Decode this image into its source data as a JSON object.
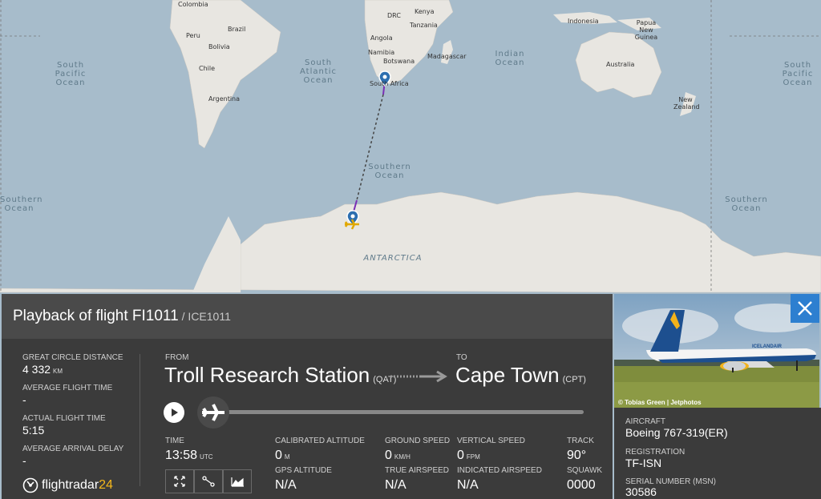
{
  "map": {
    "countries": [
      "Colombia",
      "Peru",
      "Brazil",
      "Bolivia",
      "Chile",
      "Argentina",
      "DRC",
      "Kenya",
      "Tanzania",
      "Angola",
      "Namibia",
      "Botswana",
      "Madagascar",
      "South Africa",
      "Indonesia",
      "Papua New Guinea",
      "Australia",
      "New Zealand"
    ],
    "oceans": {
      "south_pacific_left": "South\nPacific\nOcean",
      "south_atlantic": "South\nAtlantic\nOcean",
      "indian": "Indian\nOcean",
      "south_pacific_right": "South\nPacific\nOcean",
      "southern_center": "Southern\nOcean",
      "southern_left": "Southern\nOcean",
      "southern_right": "Southern\nOcean"
    },
    "continent_label": "ANTARCTICA"
  },
  "flight": {
    "title": "Playback of flight FI1011",
    "callsign": "/ ICE1011"
  },
  "stats": {
    "distance_label": "GREAT CIRCLE DISTANCE",
    "distance_value": "4 332",
    "distance_unit": "KM",
    "avg_time_label": "AVERAGE FLIGHT TIME",
    "avg_time_value": "-",
    "actual_time_label": "ACTUAL FLIGHT TIME",
    "actual_time_value": "5:15",
    "avg_delay_label": "AVERAGE ARRIVAL DELAY",
    "avg_delay_value": "-"
  },
  "route": {
    "from_label": "FROM",
    "from_city": "Troll Research Station",
    "from_code": "(QAT)",
    "to_label": "TO",
    "to_city": "Cape Town",
    "to_code": "(CPT)"
  },
  "telemetry": {
    "time_label": "TIME",
    "time_value": "13:58",
    "time_unit": "UTC",
    "cal_alt_label": "CALIBRATED ALTITUDE",
    "cal_alt_value": "0",
    "cal_alt_unit": "M",
    "gps_alt_label": "GPS ALTITUDE",
    "gps_alt_value": "N/A",
    "ground_speed_label": "GROUND SPEED",
    "ground_speed_value": "0",
    "ground_speed_unit": "KM/H",
    "true_airspeed_label": "TRUE AIRSPEED",
    "true_airspeed_value": "N/A",
    "vert_speed_label": "VERTICAL SPEED",
    "vert_speed_value": "0",
    "vert_speed_unit": "FPM",
    "ind_airspeed_label": "INDICATED AIRSPEED",
    "ind_airspeed_value": "N/A",
    "track_label": "TRACK",
    "track_value": "90°",
    "squawk_label": "SQUAWK",
    "squawk_value": "0000"
  },
  "brand": {
    "name": "flightradar",
    "suffix": "24"
  },
  "photo": {
    "credit": "© Tobias Green | Jetphotos",
    "livery_text": "ICELANDAIR"
  },
  "aircraft": {
    "aircraft_label": "AIRCRAFT",
    "aircraft_value": "Boeing 767-319(ER)",
    "registration_label": "REGISTRATION",
    "registration_value": "TF-ISN",
    "serial_label": "SERIAL NUMBER (MSN)",
    "serial_value": "30586"
  },
  "colors": {
    "accent": "#2d7fd0",
    "route_line": "#7a2fb5",
    "panel": "#3b3b3b",
    "panel_head": "#4a4a4a"
  }
}
